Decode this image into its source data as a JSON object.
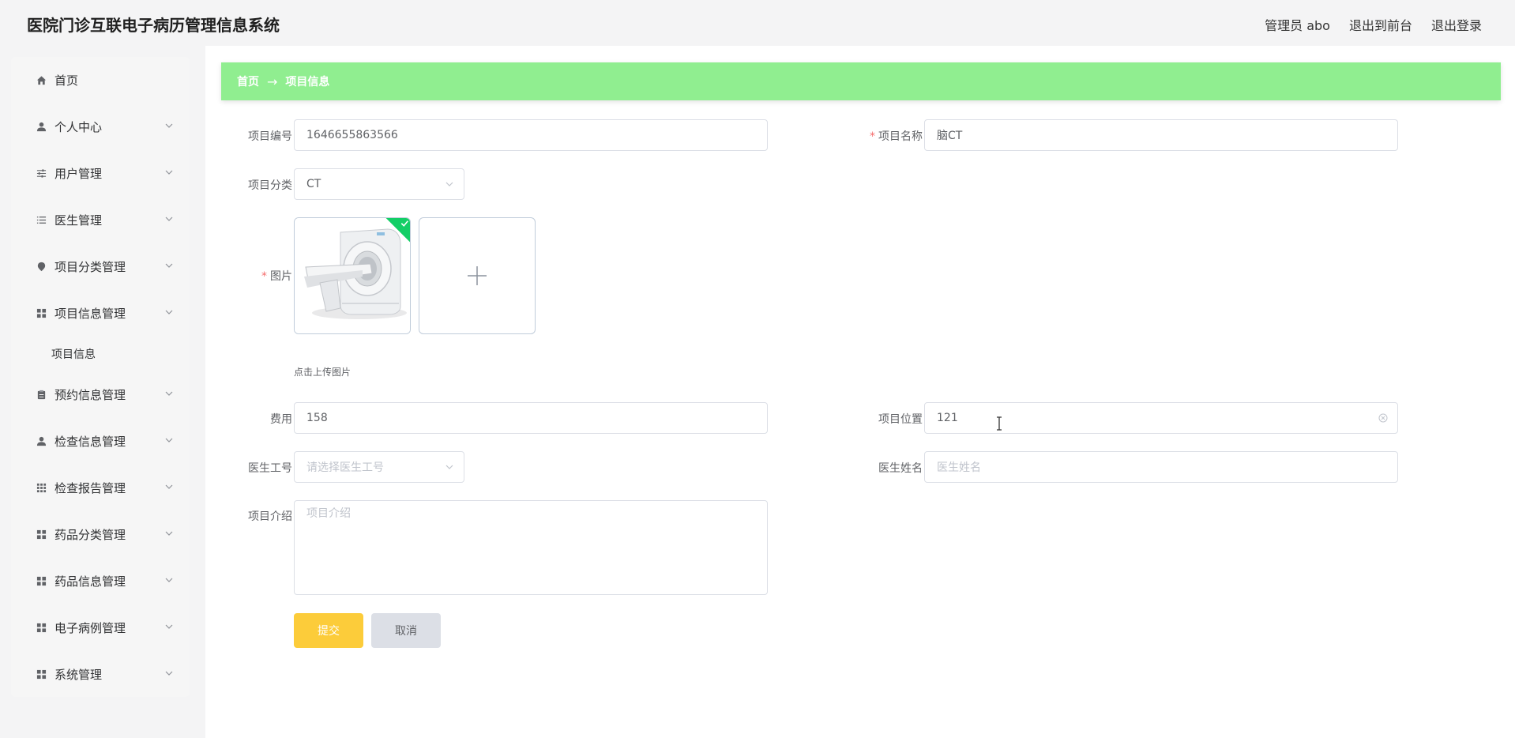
{
  "app": {
    "title": "医院门诊互联电子病历管理信息系统"
  },
  "header": {
    "user_label": "管理员 abo",
    "front_link": "退出到前台",
    "logout_link": "退出登录"
  },
  "sidebar": {
    "items": [
      {
        "label": "首页",
        "icon": "home-icon"
      },
      {
        "label": "个人中心",
        "icon": "user-icon"
      },
      {
        "label": "用户管理",
        "icon": "sliders-icon"
      },
      {
        "label": "医生管理",
        "icon": "list-icon"
      },
      {
        "label": "项目分类管理",
        "icon": "pin-icon"
      },
      {
        "label": "项目信息管理",
        "icon": "grid-icon"
      },
      {
        "label": "项目信息",
        "icon": ""
      },
      {
        "label": "预约信息管理",
        "icon": "clipboard-icon"
      },
      {
        "label": "检查信息管理",
        "icon": "user-icon"
      },
      {
        "label": "检查报告管理",
        "icon": "grid9-icon"
      },
      {
        "label": "药品分类管理",
        "icon": "grid-icon"
      },
      {
        "label": "药品信息管理",
        "icon": "grid-icon"
      },
      {
        "label": "电子病例管理",
        "icon": "grid-icon"
      },
      {
        "label": "系统管理",
        "icon": "grid-icon"
      }
    ]
  },
  "breadcrumb": {
    "home": "首页",
    "arrow": "→",
    "current": "项目信息"
  },
  "form": {
    "project_no_label": "项目编号",
    "project_no_value": "1646655863566",
    "project_name_label": "项目名称",
    "project_name_value": "脑CT",
    "category_label": "项目分类",
    "category_value": "CT",
    "image_label": "图片",
    "upload_tip": "点击上传图片",
    "fee_label": "费用",
    "fee_value": "158",
    "location_label": "项目位置",
    "location_value": "121",
    "doctor_no_label": "医生工号",
    "doctor_no_placeholder": "请选择医生工号",
    "doctor_name_label": "医生姓名",
    "doctor_name_placeholder": "医生姓名",
    "intro_label": "项目介绍",
    "intro_placeholder": "项目介绍",
    "required_mark": "*"
  },
  "buttons": {
    "submit": "提交",
    "cancel": "取消"
  },
  "colors": {
    "breadcrumb_bg": "#90ee90",
    "submit_bg": "#fccc3a",
    "cancel_bg": "#dcdfe6",
    "success_badge": "#13ce66",
    "required": "#f56c6c"
  }
}
